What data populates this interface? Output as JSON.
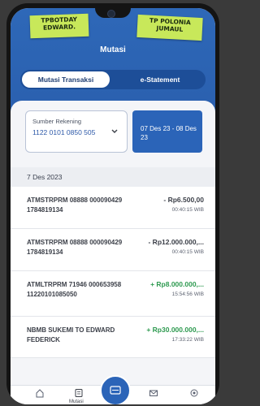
{
  "notes": {
    "left": "TPBOTDAY EDWARD.",
    "right": "TP POLONIA JUMAUL"
  },
  "header": {
    "title": "Mutasi"
  },
  "tabs": [
    {
      "label": "Mutasi Transaksi",
      "active": true
    },
    {
      "label": "e-Statement",
      "active": false
    }
  ],
  "filter": {
    "source_label": "Sumber Rekening",
    "source_value": "1122 0101 0850 505",
    "date_range": "07 Des 23 - 08 Des 23"
  },
  "date_group": "7 Des 2023",
  "transactions": [
    {
      "description": "ATMSTRPRM 08888 000090429 1784819134",
      "amount": "- Rp6.500,00",
      "time": "00:40:15 WIB",
      "type": "debit"
    },
    {
      "description": "ATMSTRPRM 08888 000090429 1784819134",
      "amount": "- Rp12.000.000,...",
      "time": "00:40:15 WIB",
      "type": "debit"
    },
    {
      "description": "ATMLTRPRM 71946 000653958 11220101085050",
      "amount": "+ Rp8.000.000,...",
      "time": "15:54:56 WIB",
      "type": "credit"
    },
    {
      "description": "NBMB SUKEMI TO EDWARD FEDERICK",
      "amount": "+ Rp30.000.000,...",
      "time": "17:33:22 WIB",
      "type": "credit"
    }
  ],
  "bottom_nav": [
    {
      "icon": "home-icon",
      "label": ""
    },
    {
      "icon": "mutasi-icon",
      "label": "Mutasi"
    },
    {
      "icon": "qris-icon",
      "label": ""
    },
    {
      "icon": "mail-icon",
      "label": ""
    },
    {
      "icon": "settings-icon",
      "label": ""
    }
  ],
  "colors": {
    "primary": "#2b64b8",
    "credit": "#2e9a50",
    "debit": "#3b3f48"
  }
}
